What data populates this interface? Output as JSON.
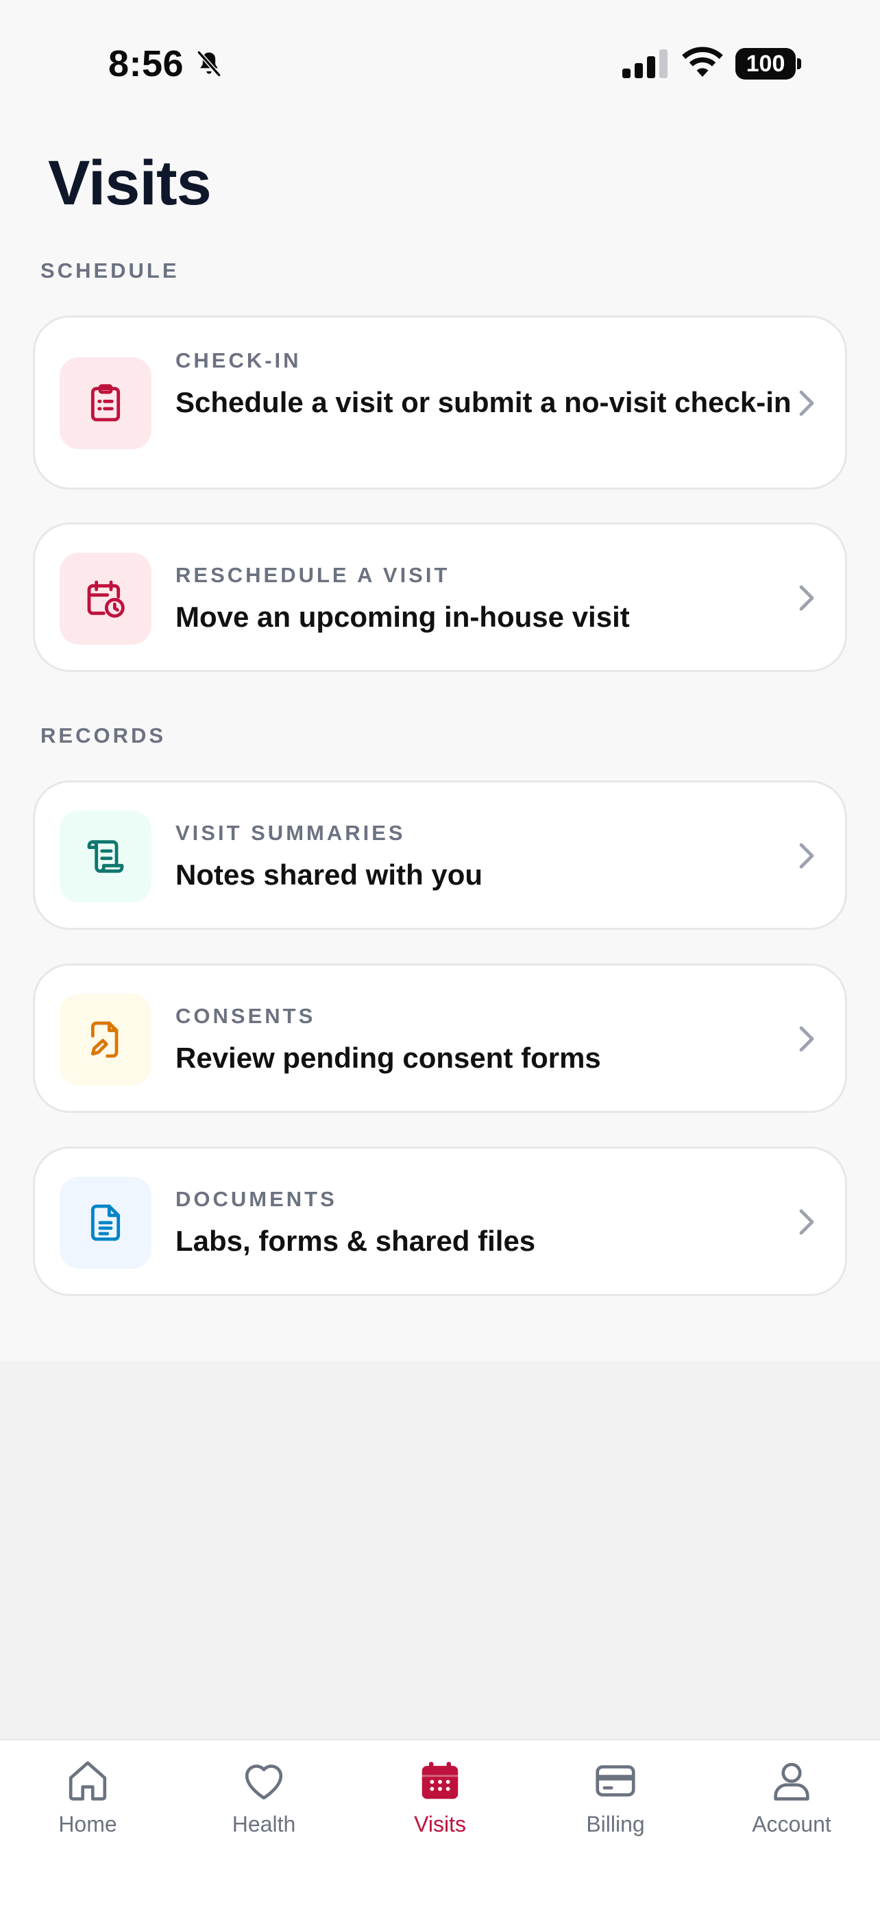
{
  "status_bar": {
    "time": "8:56",
    "battery": "100"
  },
  "header": {
    "title": "Visits"
  },
  "sections": {
    "schedule": "SCHEDULE",
    "records": "RECORDS"
  },
  "cards": {
    "checkin": {
      "kicker": "CHECK-IN",
      "title": "Schedule a visit or submit a no-visit check-in",
      "icon": "clipboard-icon"
    },
    "reschedule": {
      "kicker": "RESCHEDULE A VISIT",
      "title": "Move an upcoming in-house visit",
      "icon": "calendar-clock-icon"
    },
    "summaries": {
      "kicker": "VISIT SUMMARIES",
      "title": "Notes shared with you",
      "icon": "scroll-icon"
    },
    "consents": {
      "kicker": "CONSENTS",
      "title": "Review pending consent forms",
      "icon": "file-signature-icon"
    },
    "documents": {
      "kicker": "DOCUMENTS",
      "title": "Labs, forms & shared files",
      "icon": "file-text-icon"
    }
  },
  "tabs": {
    "home": "Home",
    "health": "Health",
    "visits": "Visits",
    "billing": "Billing",
    "account": "Account",
    "active": "Visits"
  },
  "colors": {
    "accent": "#be123c",
    "rose_bg": "#fde8ec",
    "teal": "#0f766e",
    "teal_bg": "#ecfdf8",
    "amber": "#d97706",
    "amber_bg": "#fffbeb",
    "blue": "#0284c7",
    "blue_bg": "#eff6ff"
  }
}
